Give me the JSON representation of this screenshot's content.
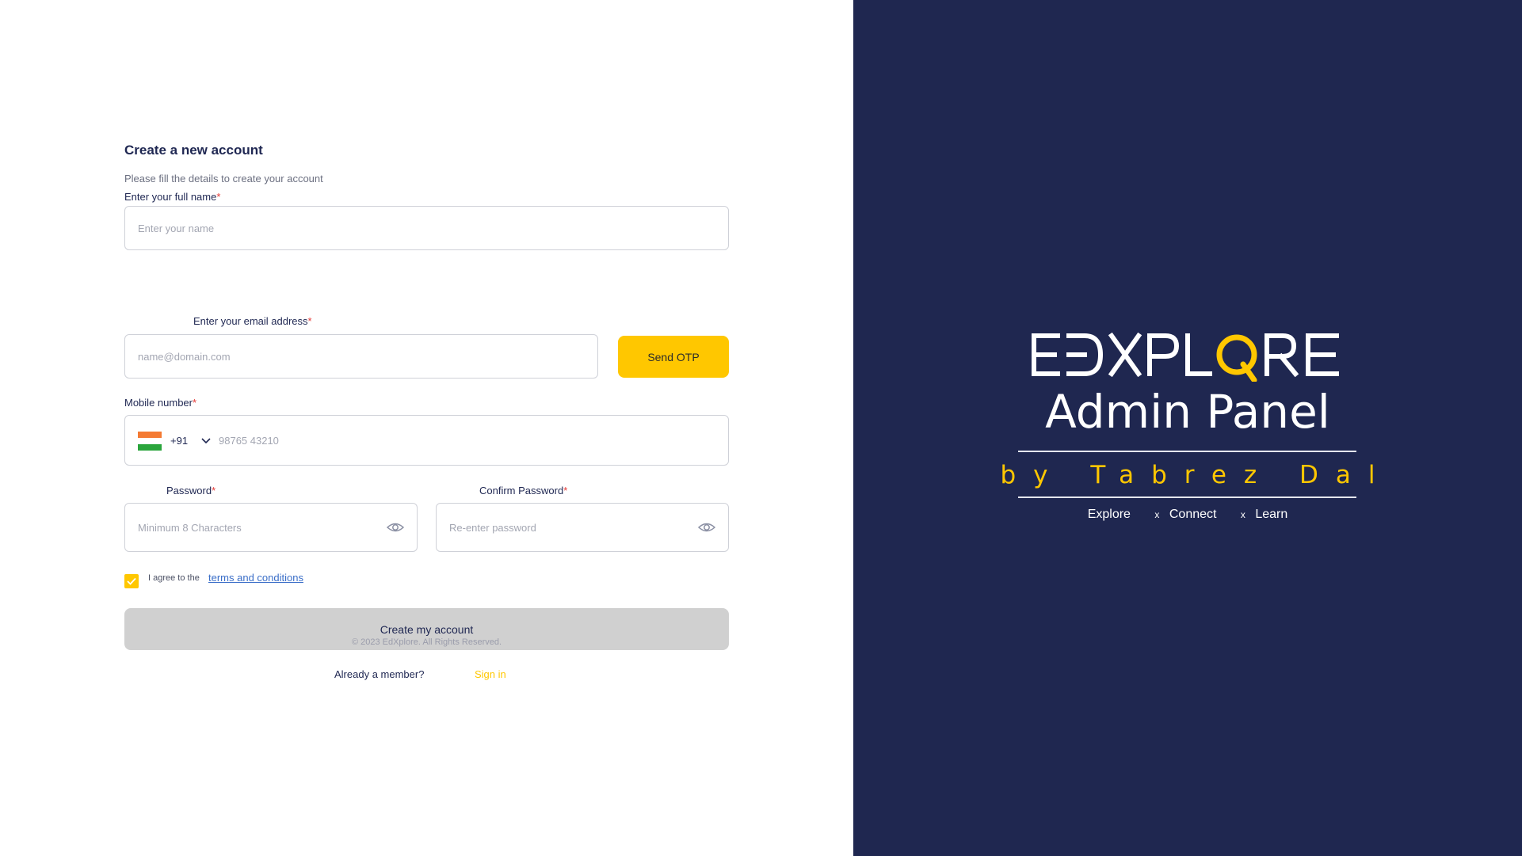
{
  "form": {
    "title": "Create a new account",
    "subtitle": "Please fill the details to create your account",
    "name": {
      "label": "Enter your full name",
      "required": "*",
      "placeholder": "Enter your name",
      "value": ""
    },
    "email": {
      "label": "Enter your email address",
      "required": "*",
      "placeholder": "name@domain.com",
      "value": "",
      "otp_button": "Send OTP"
    },
    "mobile": {
      "label": "Mobile number",
      "required": "*",
      "country_code": "+91",
      "flag_icon": "india-flag-icon",
      "placeholder": "98765 43210",
      "value": ""
    },
    "password": {
      "label": "Password",
      "required": "*",
      "placeholder": "Minimum 8 Characters",
      "icon": "eye-icon"
    },
    "confirm_password": {
      "label": "Confirm Password",
      "required": "*",
      "placeholder": "Re-enter password",
      "icon": "eye-icon"
    },
    "agree": {
      "checked": true,
      "text": "I agree to the",
      "link": "terms and conditions"
    },
    "submit": "Create my account",
    "member_text": "Already a member?",
    "signin_link": "Sign in",
    "footer": "© 2023 EdXplore. All Rights Reserved."
  },
  "brand": {
    "logo_text": "EDXPLORE",
    "panel_title": "Admin Panel",
    "byline": "by Tabrez Dal",
    "tags": [
      "Explore",
      "Connect",
      "Learn"
    ],
    "separator": "x"
  },
  "colors": {
    "accent": "#ffc700",
    "navy": "#1f2750",
    "button_disabled": "#d0d0d0",
    "link": "#3a6ec8",
    "required": "#e53935"
  }
}
